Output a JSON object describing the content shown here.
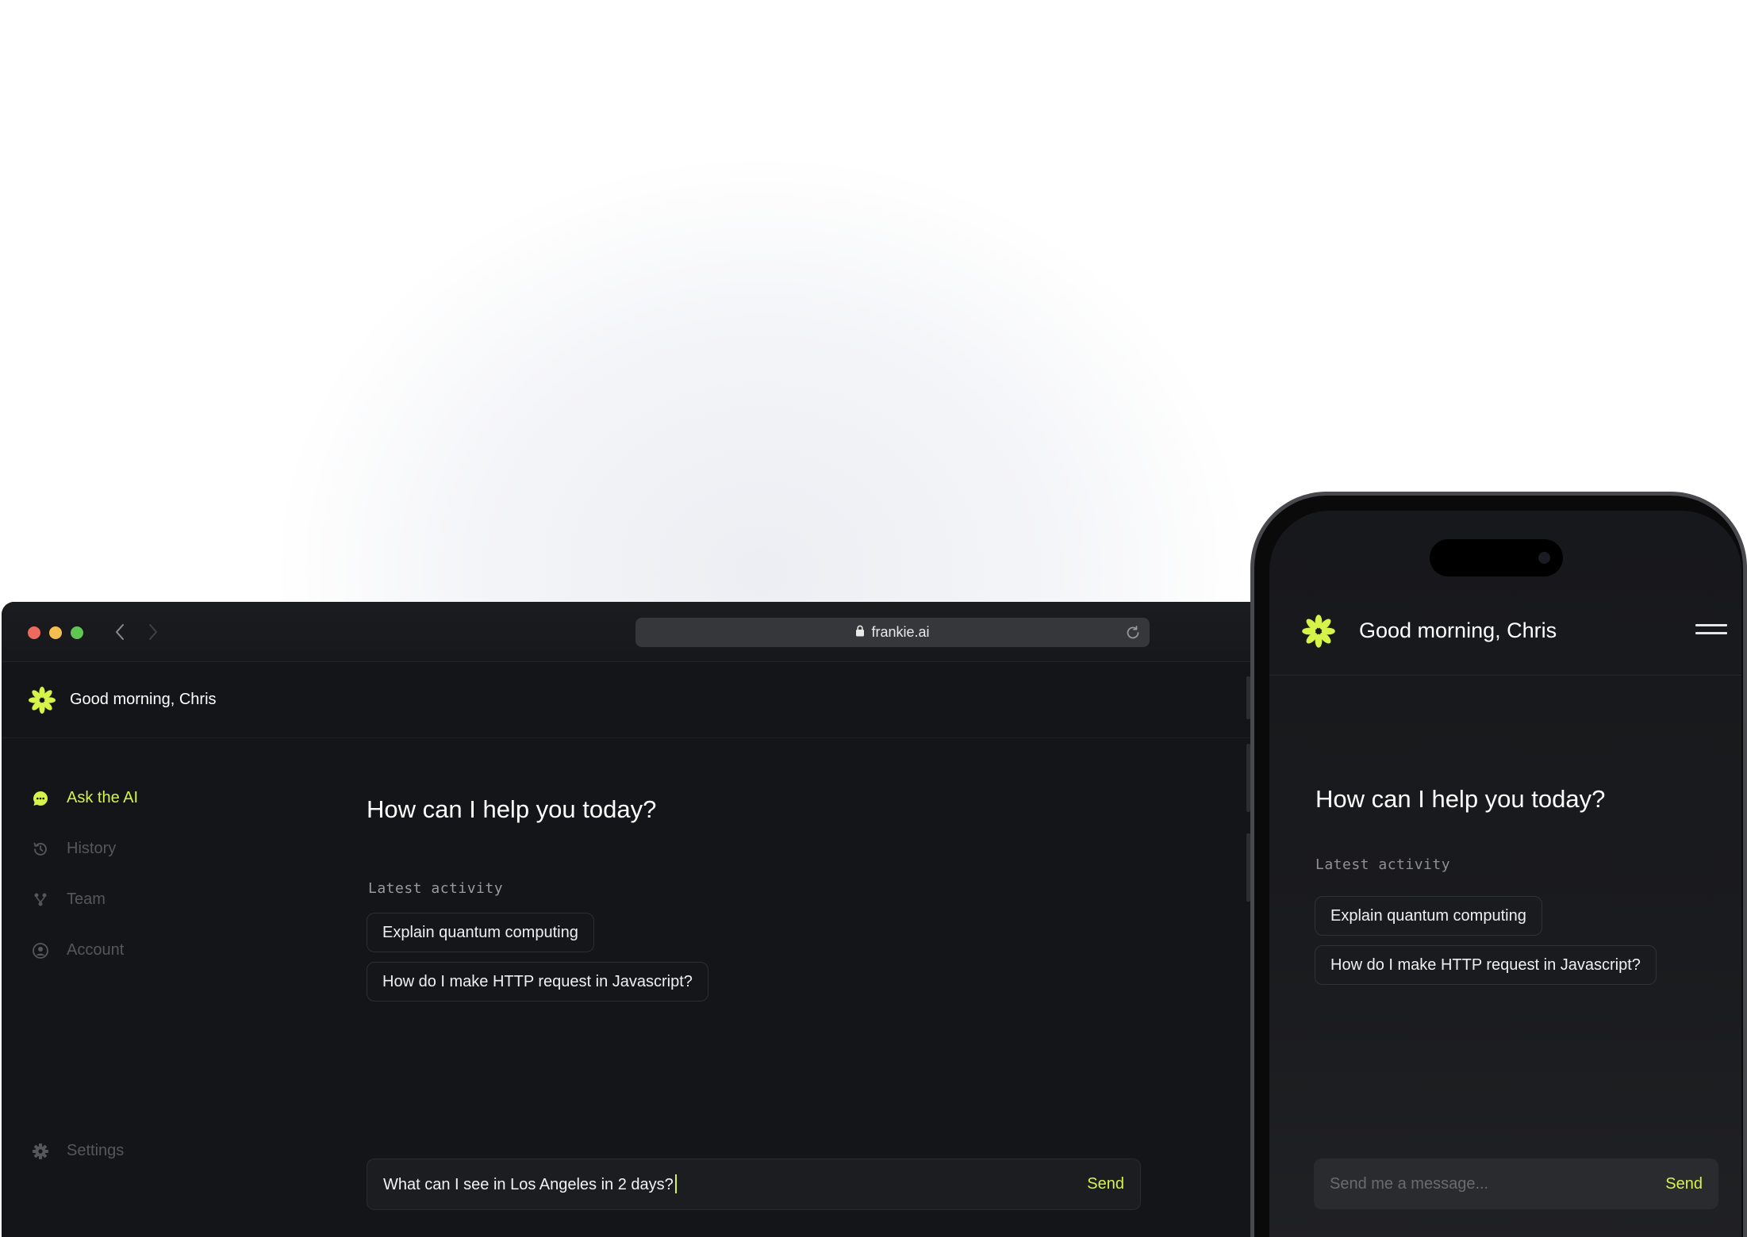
{
  "colors": {
    "accent": "#d6f34a",
    "surface": "#141518",
    "muted_text": "#55575c",
    "traffic_red": "#ed6a5e",
    "traffic_yellow": "#f5bf4f",
    "traffic_green": "#61c554"
  },
  "browser": {
    "url": "frankie.ai",
    "icons": [
      "back-icon",
      "forward-icon",
      "lock-icon",
      "reload-icon"
    ]
  },
  "app": {
    "greeting": "Good morning, Chris",
    "sidebar": {
      "items": [
        {
          "label": "Ask the AI",
          "icon": "chat-bubble-icon",
          "active": true
        },
        {
          "label": "History",
          "icon": "history-icon",
          "active": false
        },
        {
          "label": "Team",
          "icon": "team-icon",
          "active": false
        },
        {
          "label": "Account",
          "icon": "account-icon",
          "active": false
        }
      ],
      "settings": {
        "label": "Settings",
        "icon": "gear-icon"
      }
    },
    "main": {
      "title": "How can I help you today?",
      "latest_label": "Latest activity",
      "activity": [
        "Explain quantum computing",
        "How do I make HTTP request in Javascript?"
      ],
      "composer": {
        "value": "What can I see in Los Angeles in 2 days?",
        "send_label": "Send"
      }
    }
  },
  "phone": {
    "greeting": "Good morning, Chris",
    "title": "How can I help you today?",
    "latest_label": "Latest activity",
    "activity": [
      "Explain quantum computing",
      "How do I make HTTP request in Javascript?"
    ],
    "composer": {
      "placeholder": "Send me a message...",
      "send_label": "Send"
    }
  }
}
